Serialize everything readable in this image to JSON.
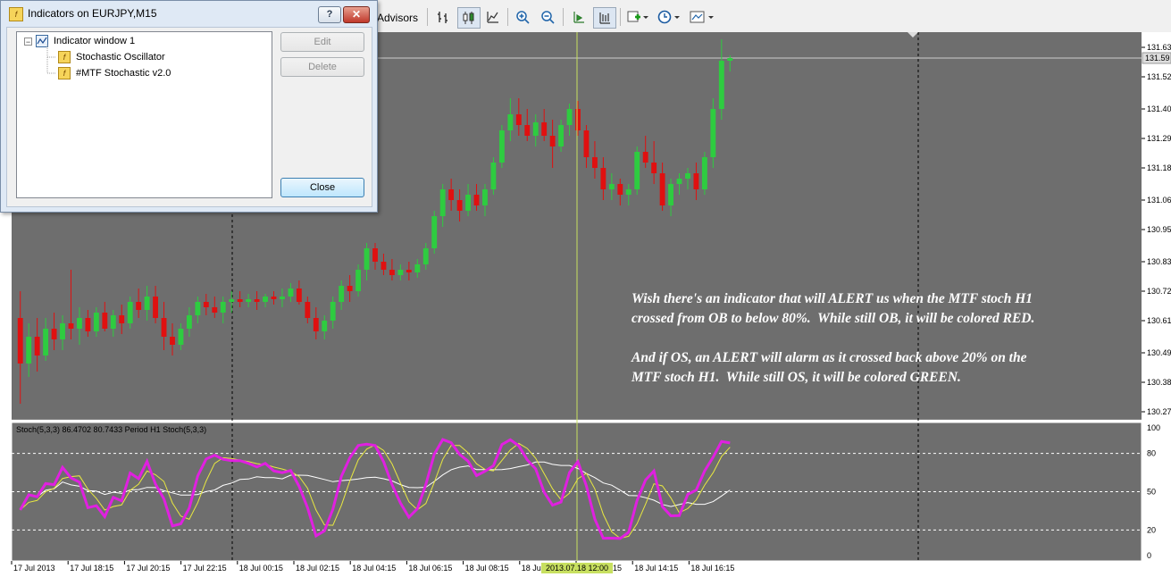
{
  "toolbar": {
    "advisors_label": "Advisors",
    "icons": [
      "bar-chart-icon",
      "candlestick-icon",
      "line-chart-icon",
      "zoom-in-icon",
      "zoom-out-icon",
      "chart-shift-icon",
      "autoscroll-icon",
      "indicators-icon",
      "periods-icon",
      "templates-icon"
    ]
  },
  "dialog": {
    "title": "Indicators on EURJPY,M15",
    "help_label": "?",
    "close_x_label": "✕",
    "tree": {
      "root_label": "Indicator window 1",
      "items": [
        "Stochastic Oscillator",
        "#MTF Stochastic v2.0"
      ]
    },
    "buttons": {
      "edit": "Edit",
      "delete": "Delete",
      "close": "Close"
    }
  },
  "chart": {
    "price_labels": [
      "131.63",
      "131.52",
      "131.40",
      "131.29",
      "131.18",
      "131.06",
      "130.95",
      "130.83",
      "130.72",
      "130.61",
      "130.49",
      "130.38",
      "130.27"
    ],
    "current_price": "131.59",
    "bid_price": 131.59,
    "indicator_header": "Stoch(5,3,3) 86.4702 80.7433   Period H1 Stoch(5,3,3)",
    "indicator_levels": [
      "100",
      "80",
      "50",
      "20",
      "0"
    ],
    "time_labels": [
      "17 Jul 2013",
      "17 Jul 18:15",
      "17 Jul 20:15",
      "17 Jul 22:15",
      "18 Jul 00:15",
      "18 Jul 02:15",
      "18 Jul 04:15",
      "18 Jul 06:15",
      "18 Jul 08:15",
      "18 Jul 10:15",
      "18 Jul 12:15",
      "18 Jul 14:15",
      "18 Jul 16:15"
    ],
    "crosshair_time": "2013.07.18 12:00",
    "colors": {
      "background": "#6e6e6e",
      "bull": "#2ecc40",
      "bear": "#e01010",
      "stoch_mtf": "#e020e0",
      "stoch_signal": "#e8e840",
      "stoch_h1": "#ffffff",
      "crosshair": "#c8e060"
    }
  },
  "chart_data": {
    "type": "candlestick",
    "symbol": "EURJPY,M15",
    "ylim": [
      130.27,
      131.66
    ],
    "candles": [
      [
        130.62,
        130.72,
        130.3,
        130.45
      ],
      [
        130.45,
        130.6,
        130.4,
        130.55
      ],
      [
        130.55,
        130.62,
        130.42,
        130.48
      ],
      [
        130.48,
        130.62,
        130.46,
        130.58
      ],
      [
        130.58,
        130.64,
        130.5,
        130.54
      ],
      [
        130.54,
        130.63,
        130.5,
        130.6
      ],
      [
        130.6,
        130.8,
        130.54,
        130.58
      ],
      [
        130.58,
        130.66,
        130.52,
        130.62
      ],
      [
        130.62,
        130.65,
        130.55,
        130.57
      ],
      [
        130.57,
        130.66,
        130.55,
        130.64
      ],
      [
        130.64,
        130.68,
        130.57,
        130.58
      ],
      [
        130.58,
        130.65,
        130.55,
        130.63
      ],
      [
        130.63,
        130.67,
        130.56,
        130.6
      ],
      [
        130.6,
        130.7,
        130.58,
        130.68
      ],
      [
        130.68,
        130.73,
        130.62,
        130.65
      ],
      [
        130.65,
        130.74,
        130.61,
        130.7
      ],
      [
        130.7,
        130.74,
        130.6,
        130.62
      ],
      [
        130.62,
        130.68,
        130.5,
        130.55
      ],
      [
        130.55,
        130.6,
        130.48,
        130.52
      ],
      [
        130.52,
        130.6,
        130.5,
        130.58
      ],
      [
        130.58,
        130.66,
        130.55,
        130.63
      ],
      [
        130.63,
        130.7,
        130.6,
        130.68
      ],
      [
        130.68,
        130.71,
        130.63,
        130.66
      ],
      [
        130.66,
        130.7,
        130.62,
        130.64
      ],
      [
        130.64,
        130.7,
        130.6,
        130.68
      ],
      [
        130.68,
        130.72,
        130.64,
        130.69
      ],
      [
        130.69,
        130.72,
        130.66,
        130.68
      ],
      [
        130.68,
        130.71,
        130.66,
        130.69
      ],
      [
        130.69,
        130.72,
        130.65,
        130.68
      ],
      [
        130.68,
        130.71,
        130.66,
        130.7
      ],
      [
        130.7,
        130.72,
        130.67,
        130.69
      ],
      [
        130.69,
        130.73,
        130.66,
        130.7
      ],
      [
        130.7,
        130.75,
        130.68,
        130.73
      ],
      [
        130.73,
        130.76,
        130.67,
        130.68
      ],
      [
        130.68,
        130.7,
        130.6,
        130.62
      ],
      [
        130.62,
        130.66,
        130.54,
        130.57
      ],
      [
        130.57,
        130.63,
        130.54,
        130.61
      ],
      [
        130.61,
        130.7,
        130.58,
        130.68
      ],
      [
        130.68,
        130.76,
        130.65,
        130.74
      ],
      [
        130.74,
        130.78,
        130.68,
        130.72
      ],
      [
        130.72,
        130.82,
        130.7,
        130.8
      ],
      [
        130.8,
        130.9,
        130.76,
        130.88
      ],
      [
        130.88,
        130.9,
        130.8,
        130.83
      ],
      [
        130.83,
        130.86,
        130.78,
        130.8
      ],
      [
        130.8,
        130.84,
        130.76,
        130.78
      ],
      [
        130.78,
        130.82,
        130.76,
        130.8
      ],
      [
        130.8,
        130.83,
        130.76,
        130.79
      ],
      [
        130.79,
        130.84,
        130.77,
        130.82
      ],
      [
        130.82,
        130.9,
        130.8,
        130.88
      ],
      [
        130.88,
        131.02,
        130.86,
        131.0
      ],
      [
        131.0,
        131.12,
        130.96,
        131.1
      ],
      [
        131.1,
        131.14,
        131.02,
        131.06
      ],
      [
        131.06,
        131.1,
        130.98,
        131.02
      ],
      [
        131.02,
        131.12,
        131.0,
        131.08
      ],
      [
        131.08,
        131.12,
        131.02,
        131.04
      ],
      [
        131.04,
        131.12,
        131.0,
        131.1
      ],
      [
        131.1,
        131.22,
        131.08,
        131.2
      ],
      [
        131.2,
        131.34,
        131.18,
        131.32
      ],
      [
        131.32,
        131.44,
        131.28,
        131.38
      ],
      [
        131.38,
        131.44,
        131.3,
        131.34
      ],
      [
        131.34,
        131.4,
        131.28,
        131.3
      ],
      [
        131.3,
        131.38,
        131.26,
        131.35
      ],
      [
        131.35,
        131.4,
        131.28,
        131.3
      ],
      [
        131.3,
        131.36,
        131.18,
        131.26
      ],
      [
        131.26,
        131.36,
        131.24,
        131.34
      ],
      [
        131.34,
        131.42,
        131.3,
        131.4
      ],
      [
        131.4,
        131.43,
        131.3,
        131.32
      ],
      [
        131.32,
        131.34,
        131.18,
        131.22
      ],
      [
        131.22,
        131.28,
        131.14,
        131.18
      ],
      [
        131.18,
        131.22,
        131.06,
        131.1
      ],
      [
        131.1,
        131.16,
        131.06,
        131.12
      ],
      [
        131.12,
        131.14,
        131.04,
        131.08
      ],
      [
        131.08,
        131.12,
        131.04,
        131.1
      ],
      [
        131.1,
        131.26,
        131.08,
        131.24
      ],
      [
        131.24,
        131.3,
        131.18,
        131.2
      ],
      [
        131.2,
        131.28,
        131.12,
        131.16
      ],
      [
        131.16,
        131.2,
        131.02,
        131.04
      ],
      [
        131.04,
        131.14,
        131.0,
        131.12
      ],
      [
        131.12,
        131.16,
        131.08,
        131.14
      ],
      [
        131.14,
        131.18,
        131.1,
        131.16
      ],
      [
        131.16,
        131.2,
        131.06,
        131.1
      ],
      [
        131.1,
        131.24,
        131.08,
        131.22
      ],
      [
        131.22,
        131.44,
        131.18,
        131.4
      ],
      [
        131.4,
        131.66,
        131.36,
        131.58
      ],
      [
        131.58,
        131.6,
        131.54,
        131.59
      ]
    ]
  }
}
